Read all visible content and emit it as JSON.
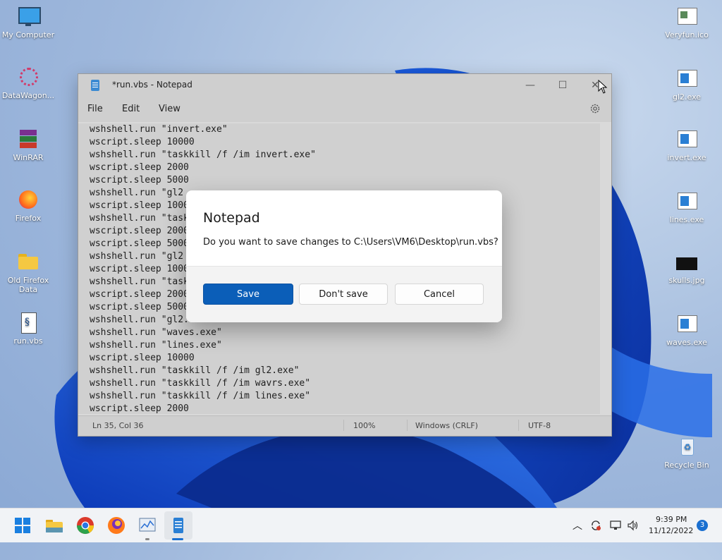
{
  "desktop": {
    "icons_left": [
      {
        "label": "My Computer"
      },
      {
        "label": "DataWagon..."
      },
      {
        "label": "WinRAR"
      },
      {
        "label": "Firefox"
      },
      {
        "label": "Old Firefox Data"
      },
      {
        "label": "run.vbs"
      }
    ],
    "icons_right": [
      {
        "label": "Veryfun.ico"
      },
      {
        "label": "gl2.exe"
      },
      {
        "label": "invert.exe"
      },
      {
        "label": "lines.exe"
      },
      {
        "label": "skulls.jpg"
      },
      {
        "label": "waves.exe"
      },
      {
        "label": "Recycle Bin"
      }
    ]
  },
  "notepad": {
    "title": "*run.vbs - Notepad",
    "menu": {
      "file": "File",
      "edit": "Edit",
      "view": "View"
    },
    "lines": [
      "wshshell.run \"invert.exe\"",
      "wscript.sleep 10000",
      "wshshell.run \"taskkill /f /im invert.exe\"",
      "wscript.sleep 2000",
      "wscript.sleep 5000",
      "wshshell.run \"gl2",
      "wscript.sleep 1000",
      "wshshell.run \"task",
      "wscript.sleep 2000",
      "wscript.sleep 5000",
      "wshshell.run \"gl2",
      "wscript.sleep 1000",
      "wshshell.run \"task",
      "wscript.sleep 2000",
      "wscript.sleep 5000",
      "wshshell.run \"gl2.exe\"",
      "wshshell.run \"waves.exe\"",
      "wshshell.run \"lines.exe\"",
      "wscript.sleep 10000",
      "wshshell.run \"taskkill /f /im gl2.exe\"",
      "wshshell.run \"taskkill /f /im wavrs.exe\"",
      "wshshell.run \"taskkill /f /im lines.exe\"",
      "wscript.sleep 2000"
    ],
    "status": {
      "position": "Ln 35, Col 36",
      "zoom": "100%",
      "line_ending": "Windows (CRLF)",
      "encoding": "UTF-8"
    }
  },
  "dialog": {
    "title": "Notepad",
    "message": "Do you want to save changes to C:\\Users\\VM6\\Desktop\\run.vbs?",
    "save": "Save",
    "dont_save": "Don't save",
    "cancel": "Cancel"
  },
  "taskbar": {
    "time": "9:39 PM",
    "date": "11/12/2022",
    "notification_count": "3"
  },
  "colors": {
    "accent": "#0b5eb8",
    "taskbar": "#f1f3f6"
  }
}
